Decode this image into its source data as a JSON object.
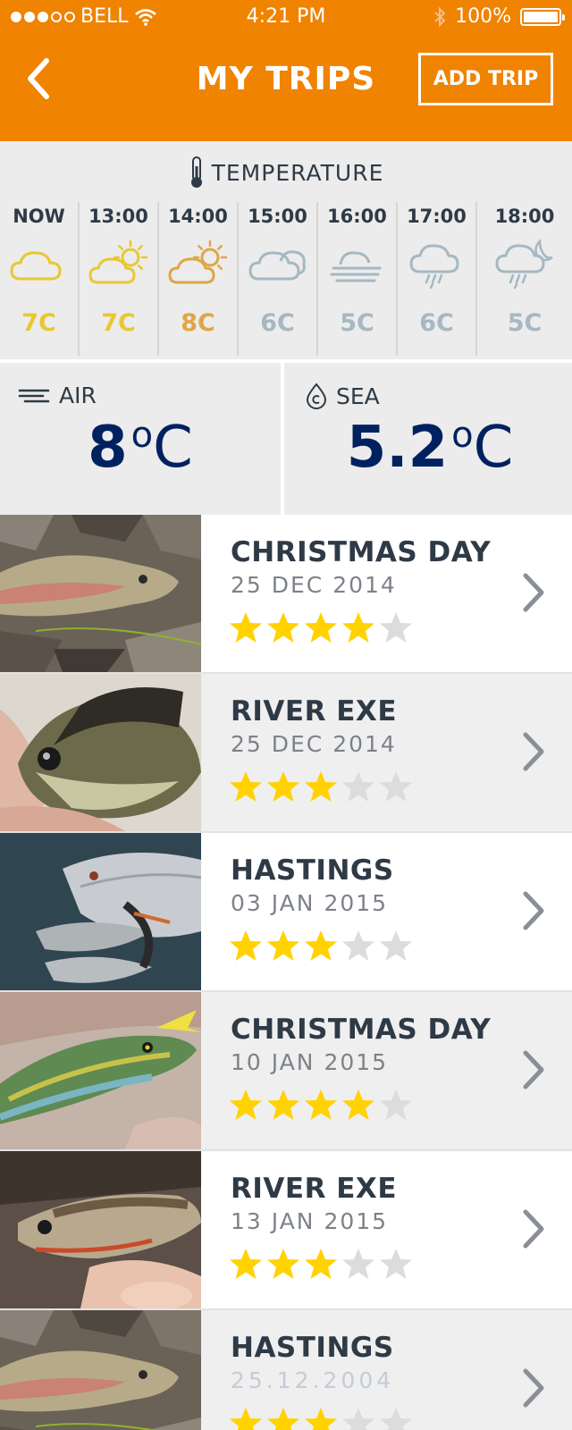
{
  "status": {
    "carrier": "BELL",
    "time": "4:21 PM",
    "battery": "100%"
  },
  "header": {
    "title": "MY TRIPS",
    "add_label": "ADD TRIP"
  },
  "temperature": {
    "label": "TEMPERATURE",
    "hours": [
      {
        "time": "NOW",
        "icon": "cloud-icon",
        "value": "7C",
        "color": "#e8c832"
      },
      {
        "time": "13:00",
        "icon": "sun-cloud-icon",
        "value": "7C",
        "color": "#e8c832"
      },
      {
        "time": "14:00",
        "icon": "sun-cloud-icon",
        "value": "8C",
        "color": "#e0a646"
      },
      {
        "time": "15:00",
        "icon": "cloudy-icon",
        "value": "6C",
        "color": "#a6b8c2"
      },
      {
        "time": "16:00",
        "icon": "fog-icon",
        "value": "5C",
        "color": "#a6b8c2"
      },
      {
        "time": "17:00",
        "icon": "rain-icon",
        "value": "6C",
        "color": "#a6b8c2"
      },
      {
        "time": "18:00",
        "icon": "night-rain-icon",
        "value": "5C",
        "color": "#a6b8c2"
      }
    ]
  },
  "env": {
    "air": {
      "label": "AIR",
      "value": "8",
      "unit": "C"
    },
    "sea": {
      "label": "SEA",
      "value": "5.2",
      "unit": "C"
    }
  },
  "colors": {
    "accent": "#f08300",
    "navy": "#002160",
    "star_on": "#ffd200",
    "star_off": "#dcdcdc"
  },
  "trips": [
    {
      "name": "CHRISTMAS DAY",
      "date": "25 DEC 2014",
      "rating": 4,
      "photo": "trout-on-rocks"
    },
    {
      "name": "RIVER EXE",
      "date": "25 DEC 2014",
      "rating": 3,
      "photo": "bluegill-in-hand"
    },
    {
      "name": "HASTINGS",
      "date": "03 JAN 2015",
      "rating": 3,
      "photo": "silver-fish-pile"
    },
    {
      "name": "CHRISTMAS DAY",
      "date": "10 JAN 2015",
      "rating": 4,
      "photo": "green-fish-with-fly"
    },
    {
      "name": "RIVER EXE",
      "date": "13 JAN 2015",
      "rating": 3,
      "photo": "brook-trout-in-hand"
    },
    {
      "name": "HASTINGS",
      "date": "25.12.2004",
      "rating": 3,
      "photo": "trout-on-rocks"
    }
  ]
}
